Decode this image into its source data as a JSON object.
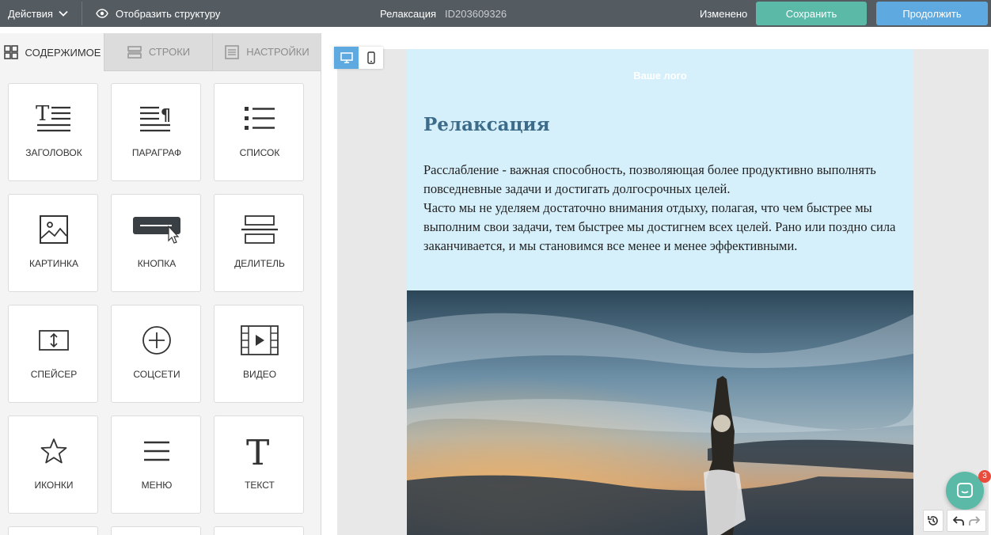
{
  "topbar": {
    "actions_label": "Действия",
    "structure_label": "Отобразить структуру",
    "doc_title": "Релаксация",
    "doc_id": "ID203609326",
    "status": "Изменено",
    "save_label": "Сохранить",
    "continue_label": "Продолжить"
  },
  "tabs": [
    {
      "label": "СОДЕРЖИМОЕ",
      "icon": "grid-icon",
      "active": true
    },
    {
      "label": "СТРОКИ",
      "icon": "rows-icon",
      "active": false
    },
    {
      "label": "НАСТРОЙКИ",
      "icon": "settings-doc-icon",
      "active": false
    }
  ],
  "blocks": [
    {
      "label": "ЗАГОЛОВОК",
      "icon": "heading-icon"
    },
    {
      "label": "ПАРАГРАФ",
      "icon": "paragraph-icon"
    },
    {
      "label": "СПИСОК",
      "icon": "list-icon"
    },
    {
      "label": "КАРТИНКА",
      "icon": "image-icon"
    },
    {
      "label": "КНОПКА",
      "icon": "button-block-icon"
    },
    {
      "label": "ДЕЛИТЕЛЬ",
      "icon": "divider-icon"
    },
    {
      "label": "СПЕЙСЕР",
      "icon": "spacer-icon"
    },
    {
      "label": "СОЦСЕТИ",
      "icon": "social-icon"
    },
    {
      "label": "ВИДЕО",
      "icon": "video-icon"
    },
    {
      "label": "ИКОНКИ",
      "icon": "star-icon"
    },
    {
      "label": "МЕНЮ",
      "icon": "menu-icon"
    },
    {
      "label": "ТЕКСТ",
      "icon": "text-icon"
    }
  ],
  "email": {
    "logo_text": "Ваше лого",
    "title": "Релаксация",
    "paragraph1": "Расслабление - важная способность, позволяющая более продуктивно выполнять повседневные задачи и достигать долгосрочных целей.",
    "paragraph2": "Часто мы не уделяем достаточно внимания отдыху, полагая, что чем быстрее мы выполним свои задачи, тем быстрее мы достигнем всех целей. Рано или поздно сила заканчивается, и мы становимся все менее и менее эффективными."
  },
  "chat": {
    "badge_count": "3"
  },
  "colors": {
    "topbar": "#545b61",
    "save": "#5bb9a8",
    "continue": "#5da9e0",
    "email_bg": "#d6f0fb",
    "title": "#3d6b8a"
  }
}
